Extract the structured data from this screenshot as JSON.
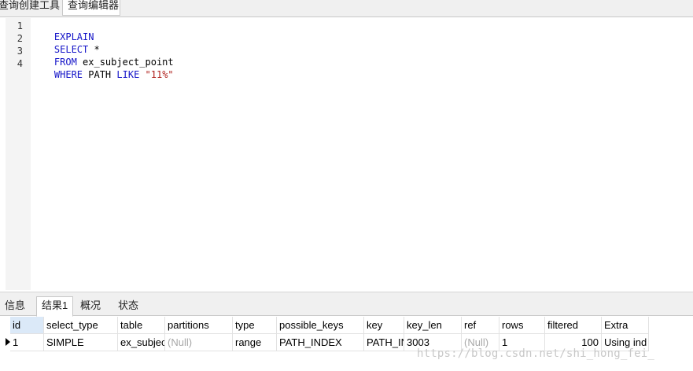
{
  "top_tabs": [
    "查询创建工具",
    "查询编辑器"
  ],
  "editor": {
    "line_numbers": [
      "1",
      "2",
      "3",
      "4"
    ],
    "lines": [
      [
        {
          "text": "EXPLAIN",
          "kind": "kw"
        }
      ],
      [
        {
          "text": "SELECT",
          "kind": "kw"
        },
        {
          "text": " *",
          "kind": "id"
        }
      ],
      [
        {
          "text": "FROM",
          "kind": "kw"
        },
        {
          "text": " ex_subject_point",
          "kind": "id"
        }
      ],
      [
        {
          "text": "WHERE",
          "kind": "kw"
        },
        {
          "text": " PATH ",
          "kind": "id"
        },
        {
          "text": "LIKE",
          "kind": "kw"
        },
        {
          "text": " ",
          "kind": "id"
        },
        {
          "text": "\"11%\"",
          "kind": "str"
        }
      ]
    ],
    "colors": {
      "keyword": "#1414c8",
      "string": "#b0221e"
    }
  },
  "bottom_tabs": [
    "信息",
    "结果1",
    "概况",
    "状态"
  ],
  "active_bottom_tab": "结果1",
  "result": {
    "columns": [
      "id",
      "select_type",
      "table",
      "partitions",
      "type",
      "possible_keys",
      "key",
      "key_len",
      "ref",
      "rows",
      "filtered",
      "Extra"
    ],
    "rows": [
      [
        "1",
        "SIMPLE",
        "ex_subjec",
        "(Null)",
        "range",
        "PATH_INDEX",
        "PATH_IN",
        "3003",
        "(Null)",
        "1",
        "100",
        "Using ind"
      ]
    ]
  },
  "watermark": "https://blog.csdn.net/shi_hong_fei_"
}
